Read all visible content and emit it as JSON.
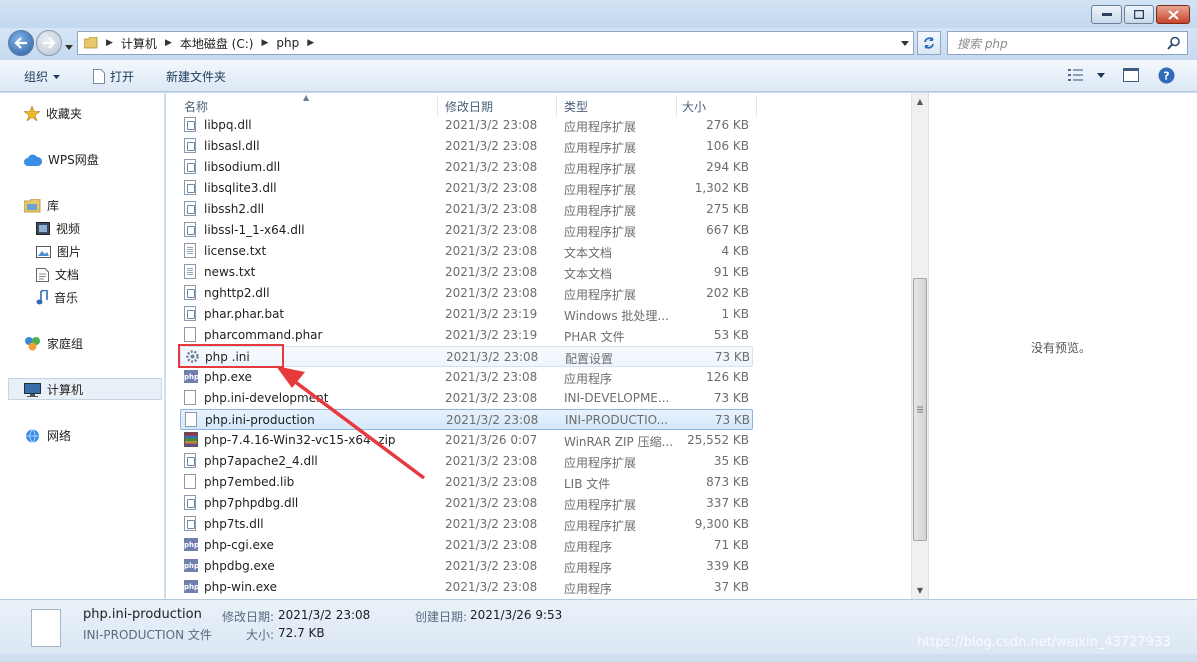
{
  "address": {
    "crumbs": [
      "计算机",
      "本地磁盘 (C:)",
      "php"
    ]
  },
  "search": {
    "placeholder": "搜索 php"
  },
  "toolbar": {
    "organize": "组织",
    "open": "打开",
    "new_folder": "新建文件夹"
  },
  "sidebar": {
    "favorites": "收藏夹",
    "wps": "WPS网盘",
    "library": "库",
    "video": "视频",
    "pictures": "图片",
    "documents": "文档",
    "music": "音乐",
    "homegroup": "家庭组",
    "computer": "计算机",
    "network": "网络"
  },
  "columns": {
    "name": "名称",
    "date": "修改日期",
    "type": "类型",
    "size": "大小"
  },
  "files": [
    {
      "name": "libpq.dll",
      "date": "2021/3/2 23:08",
      "type": "应用程序扩展",
      "size": "276 KB",
      "icon": "dll"
    },
    {
      "name": "libsasl.dll",
      "date": "2021/3/2 23:08",
      "type": "应用程序扩展",
      "size": "106 KB",
      "icon": "dll"
    },
    {
      "name": "libsodium.dll",
      "date": "2021/3/2 23:08",
      "type": "应用程序扩展",
      "size": "294 KB",
      "icon": "dll"
    },
    {
      "name": "libsqlite3.dll",
      "date": "2021/3/2 23:08",
      "type": "应用程序扩展",
      "size": "1,302 KB",
      "icon": "dll"
    },
    {
      "name": "libssh2.dll",
      "date": "2021/3/2 23:08",
      "type": "应用程序扩展",
      "size": "275 KB",
      "icon": "dll"
    },
    {
      "name": "libssl-1_1-x64.dll",
      "date": "2021/3/2 23:08",
      "type": "应用程序扩展",
      "size": "667 KB",
      "icon": "dll"
    },
    {
      "name": "license.txt",
      "date": "2021/3/2 23:08",
      "type": "文本文档",
      "size": "4 KB",
      "icon": "txt"
    },
    {
      "name": "news.txt",
      "date": "2021/3/2 23:08",
      "type": "文本文档",
      "size": "91 KB",
      "icon": "txt"
    },
    {
      "name": "nghttp2.dll",
      "date": "2021/3/2 23:08",
      "type": "应用程序扩展",
      "size": "202 KB",
      "icon": "dll"
    },
    {
      "name": "phar.phar.bat",
      "date": "2021/3/2 23:19",
      "type": "Windows 批处理...",
      "size": "1 KB",
      "icon": "dll"
    },
    {
      "name": "pharcommand.phar",
      "date": "2021/3/2 23:19",
      "type": "PHAR 文件",
      "size": "53 KB",
      "icon": "blank"
    },
    {
      "name": "php .ini",
      "date": "2021/3/2 23:08",
      "type": "配置设置",
      "size": "73 KB",
      "icon": "ini"
    },
    {
      "name": "php.exe",
      "date": "2021/3/2 23:08",
      "type": "应用程序",
      "size": "126 KB",
      "icon": "php"
    },
    {
      "name": "php.ini-development",
      "date": "2021/3/2 23:08",
      "type": "INI-DEVELOPME...",
      "size": "73 KB",
      "icon": "blank"
    },
    {
      "name": "php.ini-production",
      "date": "2021/3/2 23:08",
      "type": "INI-PRODUCTIO...",
      "size": "73 KB",
      "icon": "blank"
    },
    {
      "name": "php-7.4.16-Win32-vc15-x64 .zip",
      "date": "2021/3/26 0:07",
      "type": "WinRAR ZIP 压缩...",
      "size": "25,552 KB",
      "icon": "zip"
    },
    {
      "name": "php7apache2_4.dll",
      "date": "2021/3/2 23:08",
      "type": "应用程序扩展",
      "size": "35 KB",
      "icon": "dll"
    },
    {
      "name": "php7embed.lib",
      "date": "2021/3/2 23:08",
      "type": "LIB 文件",
      "size": "873 KB",
      "icon": "blank"
    },
    {
      "name": "php7phpdbg.dll",
      "date": "2021/3/2 23:08",
      "type": "应用程序扩展",
      "size": "337 KB",
      "icon": "dll"
    },
    {
      "name": "php7ts.dll",
      "date": "2021/3/2 23:08",
      "type": "应用程序扩展",
      "size": "9,300 KB",
      "icon": "dll"
    },
    {
      "name": "php-cgi.exe",
      "date": "2021/3/2 23:08",
      "type": "应用程序",
      "size": "71 KB",
      "icon": "php"
    },
    {
      "name": "phpdbg.exe",
      "date": "2021/3/2 23:08",
      "type": "应用程序",
      "size": "339 KB",
      "icon": "php"
    },
    {
      "name": "php-win.exe",
      "date": "2021/3/2 23:08",
      "type": "应用程序",
      "size": "37 KB",
      "icon": "php"
    }
  ],
  "preview": {
    "empty_text": "没有预览。"
  },
  "details": {
    "name": "php.ini-production",
    "type": "INI-PRODUCTION 文件",
    "modified_label": "修改日期:",
    "modified_value": "2021/3/2 23:08",
    "created_label": "创建日期:",
    "created_value": "2021/3/26 9:53",
    "size_label": "大小:",
    "size_value": "72.7 KB"
  },
  "watermark": "https://blog.csdn.net/weixin_43727933",
  "colors": {
    "annotation": "#e8393d",
    "selection": "#d5e7fb"
  }
}
